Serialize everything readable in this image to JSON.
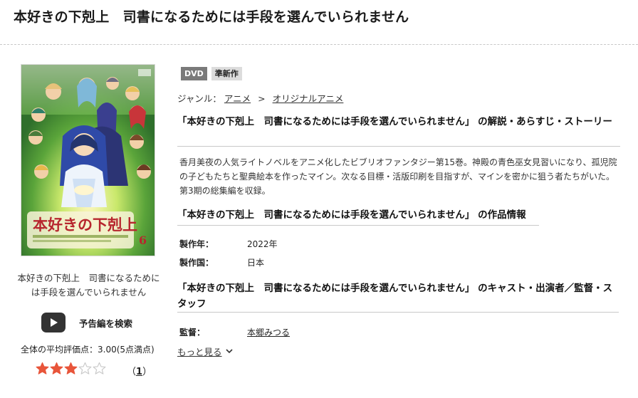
{
  "page": {
    "title": "本好きの下剋上　司書になるためには手段を選んでいられません"
  },
  "cover": {
    "title_text": "本好きの下剋上",
    "volume": "6"
  },
  "sidebar": {
    "name": "本好きの下剋上　司書になるためには手段を選んでいられません",
    "trailer_label": "予告編を検索",
    "rating_label": "全体の平均評価点：3.00(5点満点)",
    "rating_value": 3,
    "rating_max": 5,
    "review_count_open": "（",
    "review_count": "1",
    "review_count_close": "）"
  },
  "badges": [
    {
      "label": "DVD"
    },
    {
      "label": "準新作"
    }
  ],
  "genre": {
    "label": "ジャンル：",
    "items": [
      "アニメ",
      "オリジナルアニメ"
    ],
    "separator": ">"
  },
  "sections": {
    "synopsis_title": "「本好きの下剋上　司書になるためには手段を選んでいられません」 の解説・あらすじ・ストーリー",
    "synopsis_text": "香月美夜の人気ライトノベルをアニメ化したビブリオファンタジー第15巻。神殿の青色巫女見習いになり、孤児院の子どもたちと聖典絵本を作ったマイン。次なる目標・活版印刷を目指すが、マインを密かに狙う者たちがいた。第3期の総集編を収録。",
    "info_title": "「本好きの下剋上　司書になるためには手段を選んでいられません」 の作品情報",
    "info": [
      {
        "label": "製作年：",
        "value": "2022年"
      },
      {
        "label": "製作国：",
        "value": "日本"
      }
    ],
    "cast_title": "「本好きの下剋上　司書になるためには手段を選んでいられません」 のキャスト・出演者／監督・スタッフ",
    "cast": [
      {
        "label": "監督：",
        "value": "本郷みつる"
      }
    ],
    "more_label": "もっと見る"
  },
  "colors": {
    "star_filled": "#e8553a",
    "star_empty": "#c8c8c8",
    "badge_dvd": "#7a7a7a",
    "badge_new": "#dcdcdc",
    "play_button": "#333333"
  },
  "icons": [
    "play-icon",
    "star-icon",
    "chevron-down-icon"
  ]
}
